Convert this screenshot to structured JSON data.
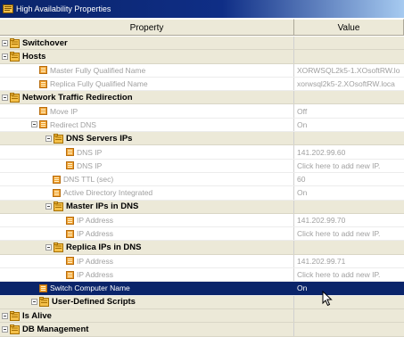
{
  "window": {
    "title": "High Availability Properties"
  },
  "header": {
    "property": "Property",
    "value": "Value"
  },
  "rows": [
    {
      "type": "group",
      "label": "Switchover"
    },
    {
      "type": "group",
      "label": "Hosts"
    },
    {
      "type": "prop",
      "label": "Master Fully Qualified Name",
      "value": "XORWSQL2k5-1.XOsoftRW.lo"
    },
    {
      "type": "prop",
      "label": "Replica Fully Qualified Name",
      "value": "xorwsql2k5-2.XOsoftRW.loca"
    },
    {
      "type": "group",
      "label": "Network Traffic Redirection"
    },
    {
      "type": "prop",
      "label": "Move IP",
      "value": "Off"
    },
    {
      "type": "prop",
      "label": "Redirect DNS",
      "value": "On"
    },
    {
      "type": "group",
      "label": "DNS Servers IPs"
    },
    {
      "type": "prop",
      "label": "DNS IP",
      "value": "141.202.99.60"
    },
    {
      "type": "prop",
      "label": "DNS IP",
      "value": "Click here to add new IP."
    },
    {
      "type": "prop",
      "label": "DNS TTL (sec)",
      "value": "60"
    },
    {
      "type": "prop",
      "label": "Active Directory Integrated",
      "value": "On"
    },
    {
      "type": "group",
      "label": "Master IPs in DNS"
    },
    {
      "type": "prop",
      "label": "IP Address",
      "value": "141.202.99.70"
    },
    {
      "type": "prop",
      "label": "IP Address",
      "value": "Click here to add new IP."
    },
    {
      "type": "group",
      "label": "Replica IPs in DNS"
    },
    {
      "type": "prop",
      "label": "IP Address",
      "value": "141.202.99.71"
    },
    {
      "type": "prop",
      "label": "IP Address",
      "value": "Click here to add new IP."
    },
    {
      "type": "prop",
      "label": "Switch Computer Name",
      "value": "On"
    },
    {
      "type": "group",
      "label": "User-Defined Scripts"
    },
    {
      "type": "group",
      "label": "Is Alive"
    },
    {
      "type": "group",
      "label": "DB Management"
    }
  ]
}
